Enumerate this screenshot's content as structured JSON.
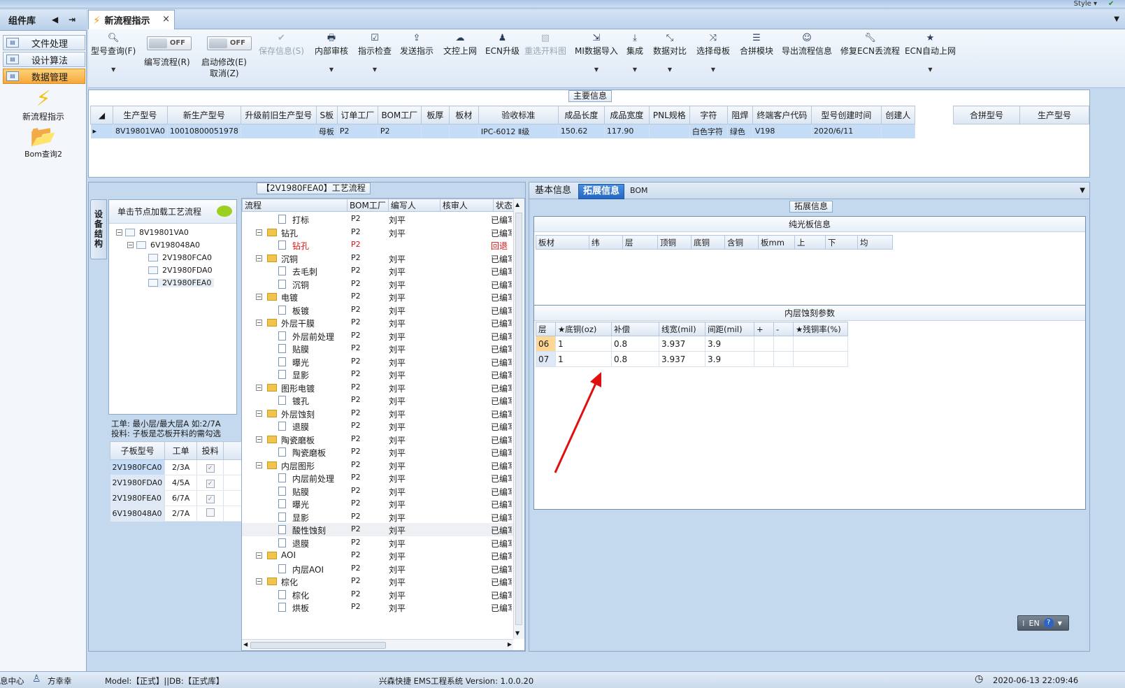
{
  "topstrip": {
    "style_label": "Style ▾"
  },
  "sidebar": {
    "title": "组件库",
    "items": [
      {
        "label": "文件处理"
      },
      {
        "label": "设计算法"
      },
      {
        "label": "数据管理"
      }
    ],
    "big_items": [
      {
        "label": "新流程指示"
      },
      {
        "label": "Bom查询2"
      }
    ]
  },
  "tabs": {
    "active": "新流程指示",
    "close": "×"
  },
  "ribbon": {
    "query": "型号查询(F)",
    "write_flow": "编写流程(R)",
    "start_modify": "启动修改(E)",
    "cancel": "取消(Z)",
    "toggle_off": "OFF",
    "buttons": [
      "保存信息(S)",
      "内部审核",
      "指示检查",
      "发送指示",
      "文控上网",
      "ECN升级",
      "重选开料图",
      "MI数据导入",
      "集成",
      "数据对比",
      "选择母板",
      "合拼模块",
      "导出流程信息",
      "修复ECN丢流程",
      "ECN自动上网"
    ]
  },
  "main_info": {
    "title": "主要信息",
    "columns": [
      "生产型号",
      "新生产型号",
      "升级前旧生产型号",
      "S板",
      "订单工厂",
      "BOM工厂",
      "板厚",
      "板材",
      "验收标准",
      "成品长度",
      "成品宽度",
      "PNL规格",
      "字符",
      "阻焊",
      "终端客户代码",
      "型号创建时间",
      "创建人"
    ],
    "row": [
      "8V19801VA0",
      "10010800051978",
      "",
      "母板",
      "P2",
      "P2",
      "",
      "",
      "IPC-6012 Ⅱ级",
      "150.62",
      "117.90",
      "",
      "白色字符",
      "绿色",
      "V198",
      "2020/6/11",
      ""
    ],
    "merge_columns": [
      "合拼型号",
      "生产型号"
    ]
  },
  "process": {
    "title": "【2V1980FEA0】工艺流程",
    "vtab": "设备结构",
    "tree_header": "单击节点加载工艺流程",
    "tree": [
      "8V19801VA0",
      "6V198048A0",
      "2V1980FCA0",
      "2V1980FDA0",
      "2V1980FEA0"
    ],
    "note1": "工单: 最小层/最大层A 如:2/7A",
    "note2": "投料: 子板是芯板开料的需勾选",
    "sub_columns": [
      "子板型号",
      "工单",
      "投料"
    ],
    "sub_rows": [
      [
        "2V1980FCA0",
        "2/3A",
        "✓"
      ],
      [
        "2V1980FDA0",
        "4/5A",
        "✓"
      ],
      [
        "2V1980FEA0",
        "6/7A",
        "✓"
      ],
      [
        "6V198048A0",
        "2/7A",
        ""
      ]
    ],
    "flow_columns": [
      "流程",
      "BOM工厂",
      "编写人",
      "核审人",
      "状态"
    ],
    "flow_rows": [
      {
        "t": "打标",
        "d": 2,
        "f": "P2",
        "w": "刘平",
        "s": "已编写"
      },
      {
        "t": "钻孔",
        "d": 1,
        "f": "P2",
        "w": "刘平",
        "s": "已编写"
      },
      {
        "t": "钻孔",
        "d": 2,
        "f": "P2",
        "w": "",
        "s": "回退",
        "red": true
      },
      {
        "t": "沉铜",
        "d": 1,
        "f": "P2",
        "w": "刘平",
        "s": "已编写"
      },
      {
        "t": "去毛刺",
        "d": 2,
        "f": "P2",
        "w": "刘平",
        "s": "已编写"
      },
      {
        "t": "沉铜",
        "d": 2,
        "f": "P2",
        "w": "刘平",
        "s": "已编写"
      },
      {
        "t": "电镀",
        "d": 1,
        "f": "P2",
        "w": "刘平",
        "s": "已编写"
      },
      {
        "t": "板镀",
        "d": 2,
        "f": "P2",
        "w": "刘平",
        "s": "已编写"
      },
      {
        "t": "外层干膜",
        "d": 1,
        "f": "P2",
        "w": "刘平",
        "s": "已编写"
      },
      {
        "t": "外层前处理",
        "d": 2,
        "f": "P2",
        "w": "刘平",
        "s": "已编写"
      },
      {
        "t": "贴膜",
        "d": 2,
        "f": "P2",
        "w": "刘平",
        "s": "已编写"
      },
      {
        "t": "曝光",
        "d": 2,
        "f": "P2",
        "w": "刘平",
        "s": "已编写"
      },
      {
        "t": "显影",
        "d": 2,
        "f": "P2",
        "w": "刘平",
        "s": "已编写"
      },
      {
        "t": "图形电镀",
        "d": 1,
        "f": "P2",
        "w": "刘平",
        "s": "已编写"
      },
      {
        "t": "镀孔",
        "d": 2,
        "f": "P2",
        "w": "刘平",
        "s": "已编写"
      },
      {
        "t": "外层蚀刻",
        "d": 1,
        "f": "P2",
        "w": "刘平",
        "s": "已编写"
      },
      {
        "t": "退膜",
        "d": 2,
        "f": "P2",
        "w": "刘平",
        "s": "已编写"
      },
      {
        "t": "陶瓷磨板",
        "d": 1,
        "f": "P2",
        "w": "刘平",
        "s": "已编写"
      },
      {
        "t": "陶瓷磨板",
        "d": 2,
        "f": "P2",
        "w": "刘平",
        "s": "已编写"
      },
      {
        "t": "内层图形",
        "d": 1,
        "f": "P2",
        "w": "刘平",
        "s": "已编写"
      },
      {
        "t": "内层前处理",
        "d": 2,
        "f": "P2",
        "w": "刘平",
        "s": "已编写"
      },
      {
        "t": "贴膜",
        "d": 2,
        "f": "P2",
        "w": "刘平",
        "s": "已编写"
      },
      {
        "t": "曝光",
        "d": 2,
        "f": "P2",
        "w": "刘平",
        "s": "已编写"
      },
      {
        "t": "显影",
        "d": 2,
        "f": "P2",
        "w": "刘平",
        "s": "已编写"
      },
      {
        "t": "酸性蚀刻",
        "d": 2,
        "f": "P2",
        "w": "刘平",
        "s": "已编写",
        "hl": true
      },
      {
        "t": "退膜",
        "d": 2,
        "f": "P2",
        "w": "刘平",
        "s": "已编写"
      },
      {
        "t": "AOI",
        "d": 1,
        "f": "P2",
        "w": "刘平",
        "s": "已编写"
      },
      {
        "t": "内层AOI",
        "d": 2,
        "f": "P2",
        "w": "刘平",
        "s": "已编写"
      },
      {
        "t": "棕化",
        "d": 1,
        "f": "P2",
        "w": "刘平",
        "s": "已编写"
      },
      {
        "t": "棕化",
        "d": 2,
        "f": "P2",
        "w": "刘平",
        "s": "已编写"
      },
      {
        "t": "烘板",
        "d": 2,
        "f": "P2",
        "w": "刘平",
        "s": "已编写"
      }
    ]
  },
  "right": {
    "tabs": [
      "基本信息",
      "拓展信息",
      "BOM"
    ],
    "group_title": "拓展信息",
    "plain_title": "纯光板信息",
    "plain_columns": [
      "板材",
      "纬",
      "层",
      "顶铜",
      "底铜",
      "含铜",
      "板mm",
      "上",
      "下",
      "均"
    ],
    "etch_title": "内层蚀刻参数",
    "etch_columns": [
      "层",
      "★底铜(oz)",
      "补偿",
      "线宽(mil)",
      "间距(mil)",
      "+",
      "-",
      "★残铜率(%)"
    ],
    "etch_rows": [
      [
        "06",
        "1",
        "0.8",
        "3.937",
        "3.9",
        "",
        "",
        ""
      ],
      [
        "07",
        "1",
        "0.8",
        "3.937",
        "3.9",
        "",
        "",
        ""
      ]
    ]
  },
  "lang": {
    "label": "EN",
    "help": "?"
  },
  "status": {
    "left": "息中心",
    "user": "方幸幸",
    "model": "Model:【正式】||DB:【正式库】",
    "system": "兴森快捷 EMS工程系统 Version: 1.0.0.20",
    "datetime": "2020-06-13 22:09:46"
  },
  "colors": {
    "accent": "#2367c4",
    "active_nav": "#f6a83b",
    "annotation_arrow": "#e01010"
  }
}
